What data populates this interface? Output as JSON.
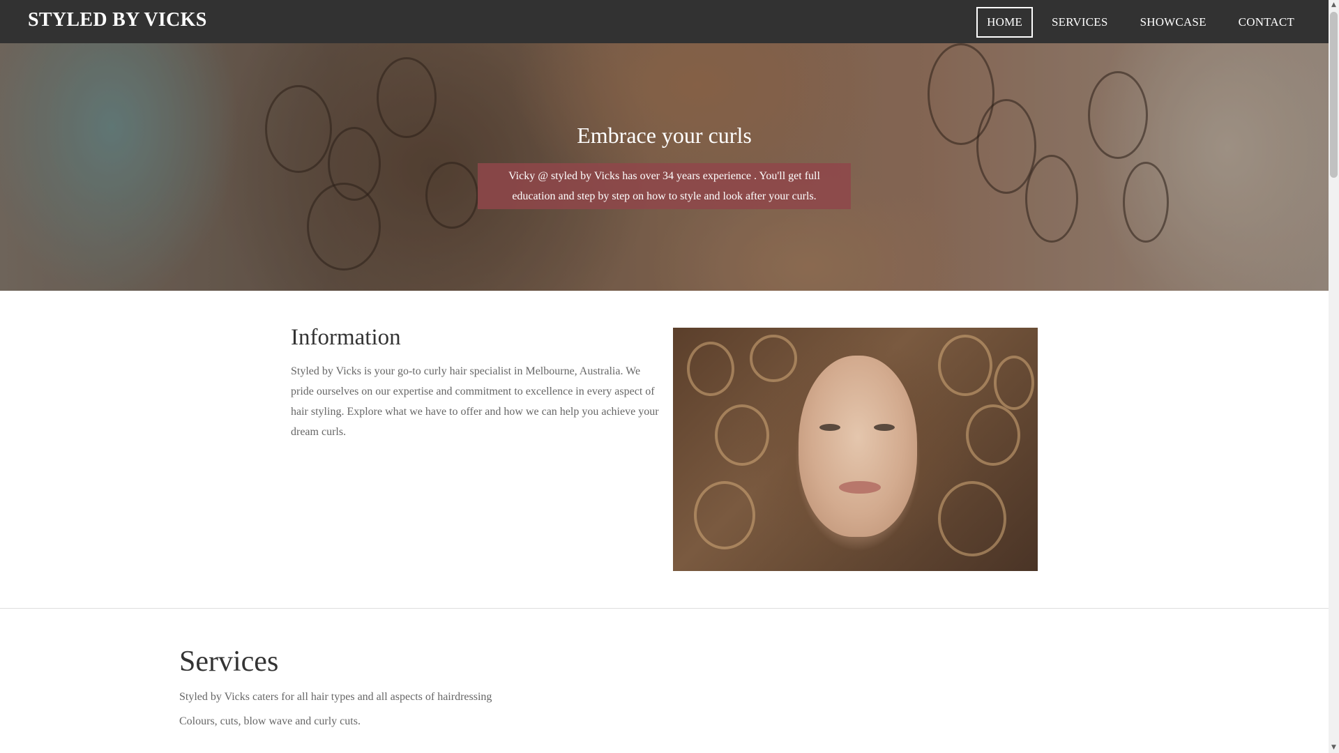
{
  "nav": {
    "brand": "STYLED BY VICKS",
    "links": [
      {
        "label": "HOME",
        "active": true
      },
      {
        "label": "SERVICES",
        "active": false
      },
      {
        "label": "SHOWCASE",
        "active": false
      },
      {
        "label": "CONTACT",
        "active": false
      }
    ]
  },
  "hero": {
    "title": "Embrace your curls",
    "lines": [
      "Vicky @ styled by Vicks  has over 34 years experience . You'll get full",
      "education and step by step on how to style and look after your curls."
    ]
  },
  "info": {
    "title": "Information",
    "text": "Styled by Vicks is your go-to curly hair specialist in Melbourne, Australia. We pride ourselves on our expertise and commitment to excellence in every aspect of hair styling. Explore what we have to offer and how we can help you achieve your dream curls."
  },
  "services": {
    "title": "Services",
    "lines": [
      "Styled by Vicks caters for all hair types and all aspects of hairdressing",
      "Colours, cuts, blow wave and curly cuts."
    ]
  },
  "colors": {
    "navbar": "#323232",
    "hero_box": "#8f464a",
    "heading": "#333333",
    "body_text": "#666666"
  },
  "icons": {
    "scroll_up": "scroll-up-arrow-icon",
    "scroll_down": "scroll-down-arrow-icon"
  }
}
